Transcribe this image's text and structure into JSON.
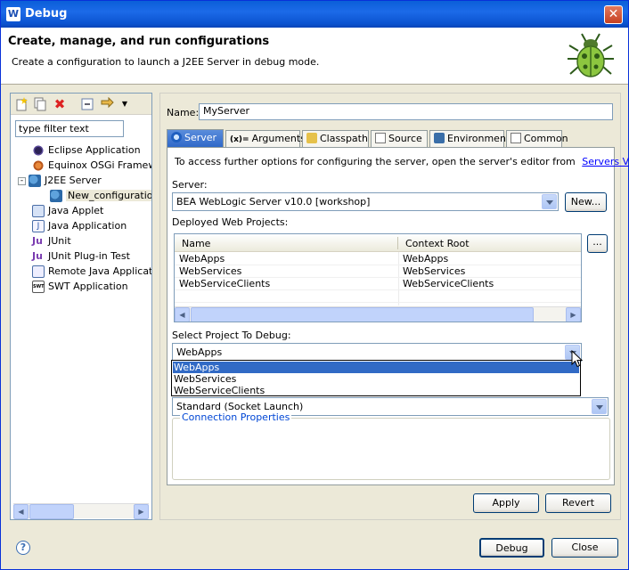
{
  "window": {
    "title": "Debug",
    "close_symbol": "✕"
  },
  "banner": {
    "heading": "Create, manage, and run configurations",
    "description": "Create a configuration to launch a J2EE Server in debug mode."
  },
  "filter": {
    "value": "type filter text"
  },
  "tree": {
    "items": [
      {
        "label": "Eclipse Application",
        "icon": "eclipse-icon"
      },
      {
        "label": "Equinox OSGi Framewo",
        "icon": "osgi-icon"
      },
      {
        "label": "J2EE Server",
        "icon": "server-icon"
      },
      {
        "label": "New_configuration",
        "icon": "server-config-icon"
      },
      {
        "label": "Java Applet",
        "icon": "applet-icon"
      },
      {
        "label": "Java Application",
        "icon": "java-app-icon"
      },
      {
        "label": "JUnit",
        "icon": "junit-icon"
      },
      {
        "label": "JUnit Plug-in Test",
        "icon": "junit-plugin-icon"
      },
      {
        "label": "Remote Java Applicati",
        "icon": "remote-java-icon"
      },
      {
        "label": "SWT Application",
        "icon": "swt-icon"
      }
    ]
  },
  "form": {
    "name_label": "Name:",
    "name_value": "MyServer"
  },
  "tabs": [
    {
      "label": "Server"
    },
    {
      "label": "Arguments"
    },
    {
      "label": "Classpath"
    },
    {
      "label": "Source"
    },
    {
      "label": "Environment"
    },
    {
      "label": "Common"
    }
  ],
  "server_tab": {
    "info_text": "To access further options for configuring the server, open the server's editor from",
    "info_link": "Servers View",
    "server_label": "Server:",
    "server_value": "BEA WebLogic Server v10.0 [workshop]",
    "new_button": "New...",
    "deployed_label": "Deployed Web Projects:",
    "table_columns": [
      "Name",
      "Context Root"
    ],
    "table_rows": [
      [
        "WebApps",
        "WebApps"
      ],
      [
        "WebServices",
        "WebServices"
      ],
      [
        "WebServiceClients",
        "WebServiceClients"
      ]
    ],
    "ellipsis_button": "...",
    "select_project_label": "Select Project To Debug:",
    "select_project_value": "WebApps",
    "dropdown_options": [
      "WebApps",
      "WebServices",
      "WebServiceClients"
    ],
    "launch_value": "Standard (Socket Launch)",
    "connection_properties": "Connection Properties"
  },
  "buttons": {
    "apply": "Apply",
    "revert": "Revert",
    "debug": "Debug",
    "close": "Close"
  },
  "help": {
    "symbol": "?"
  }
}
